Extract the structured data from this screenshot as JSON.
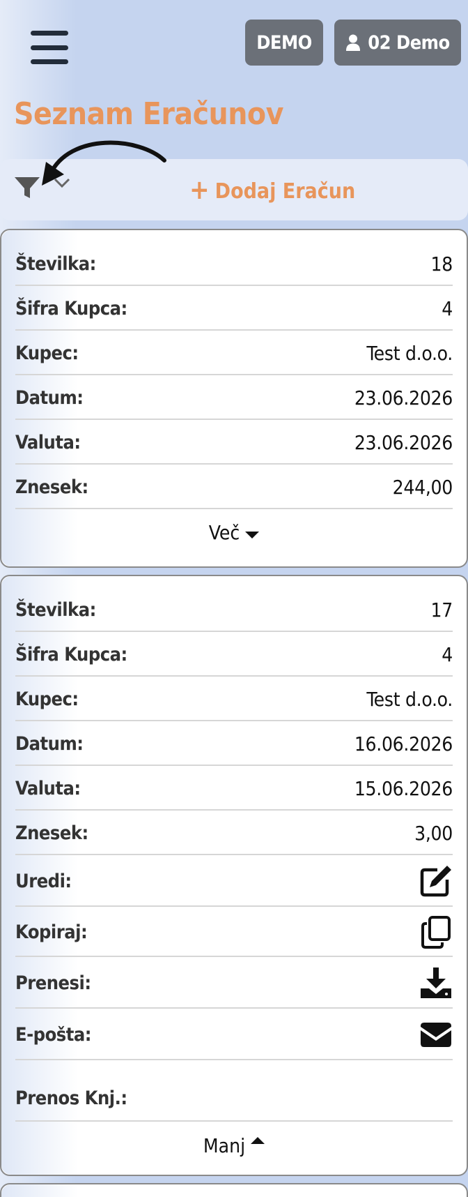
{
  "header": {
    "demo_label": "DEMO",
    "user_label": "02 Demo",
    "user_icon": "user-icon",
    "menu_icon": "hamburger-menu-icon"
  },
  "page": {
    "title": "Seznam Eračunov"
  },
  "toolbar": {
    "filter_icon": "filter-icon",
    "chevron_icon": "chevron-down-icon",
    "add_label": "Dodaj Eračun"
  },
  "colors": {
    "accent": "#e8955b",
    "background": "#c5d4ef",
    "button": "#6b7078"
  },
  "invoices": [
    {
      "fields": [
        {
          "label": "Številka:",
          "value": "18"
        },
        {
          "label": "Šifra Kupca:",
          "value": "4"
        },
        {
          "label": "Kupec:",
          "value": "Test d.o.o."
        },
        {
          "label": "Datum:",
          "value": "23.06.2026"
        },
        {
          "label": "Valuta:",
          "value": "23.06.2026"
        },
        {
          "label": "Znesek:",
          "value": "244,00"
        }
      ],
      "toggle_label": "Več"
    },
    {
      "fields": [
        {
          "label": "Številka:",
          "value": "17"
        },
        {
          "label": "Šifra Kupca:",
          "value": "4"
        },
        {
          "label": "Kupec:",
          "value": "Test d.o.o."
        },
        {
          "label": "Datum:",
          "value": "16.06.2026"
        },
        {
          "label": "Valuta:",
          "value": "15.06.2026"
        },
        {
          "label": "Znesek:",
          "value": "3,00"
        }
      ],
      "actions": [
        {
          "label": "Uredi:",
          "icon": "edit-icon"
        },
        {
          "label": "Kopiraj:",
          "icon": "copy-icon"
        },
        {
          "label": "Prenesi:",
          "icon": "download-icon"
        },
        {
          "label": "E-pošta:",
          "icon": "envelope-icon"
        }
      ],
      "transfer_label": "Prenos Knj.:",
      "toggle_label": "Manj"
    }
  ]
}
